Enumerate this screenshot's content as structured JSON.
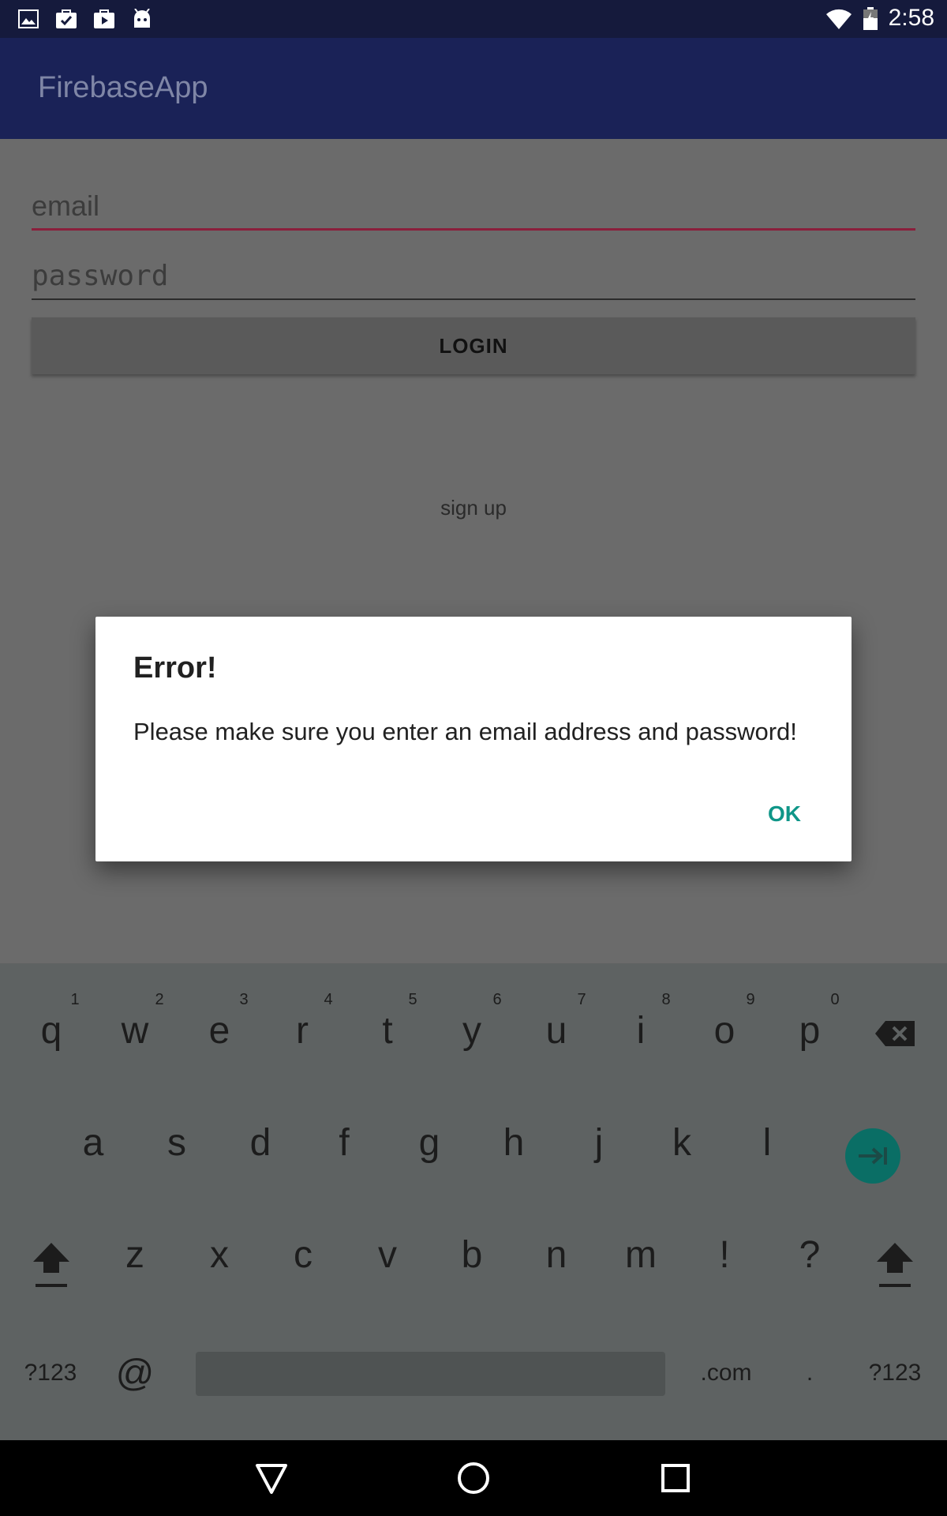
{
  "status_bar": {
    "time": "2:58"
  },
  "app_bar": {
    "title": "FirebaseApp"
  },
  "login_form": {
    "email_placeholder": "email",
    "password_placeholder": "password",
    "login_label": "LOGIN",
    "signup_label": "sign up"
  },
  "dialog": {
    "title": "Error!",
    "message": "Please make sure you enter an email address and password!",
    "ok_label": "OK"
  },
  "keyboard": {
    "row1": [
      "q",
      "w",
      "e",
      "r",
      "t",
      "y",
      "u",
      "i",
      "o",
      "p"
    ],
    "row1_hints": [
      "1",
      "2",
      "3",
      "4",
      "5",
      "6",
      "7",
      "8",
      "9",
      "0"
    ],
    "row2": [
      "a",
      "s",
      "d",
      "f",
      "g",
      "h",
      "j",
      "k",
      "l"
    ],
    "row3": [
      "z",
      "x",
      "c",
      "v",
      "b",
      "n",
      "m",
      "!",
      "?"
    ],
    "symbols_label": "?123",
    "at_label": "@",
    "dotcom_label": ".com",
    "period_label": "."
  },
  "colors": {
    "status_bar": "#151a3c",
    "app_bar": "#1a2257",
    "accent": "#0f9688",
    "email_underline": "#8a1f3c"
  },
  "icons": [
    "image-icon",
    "checkbox-bag-icon",
    "play-store-icon",
    "android-icon",
    "wifi-icon",
    "battery-icon",
    "backspace-icon",
    "enter-next-icon",
    "shift-icon",
    "nav-back-icon",
    "nav-home-icon",
    "nav-recents-icon"
  ]
}
